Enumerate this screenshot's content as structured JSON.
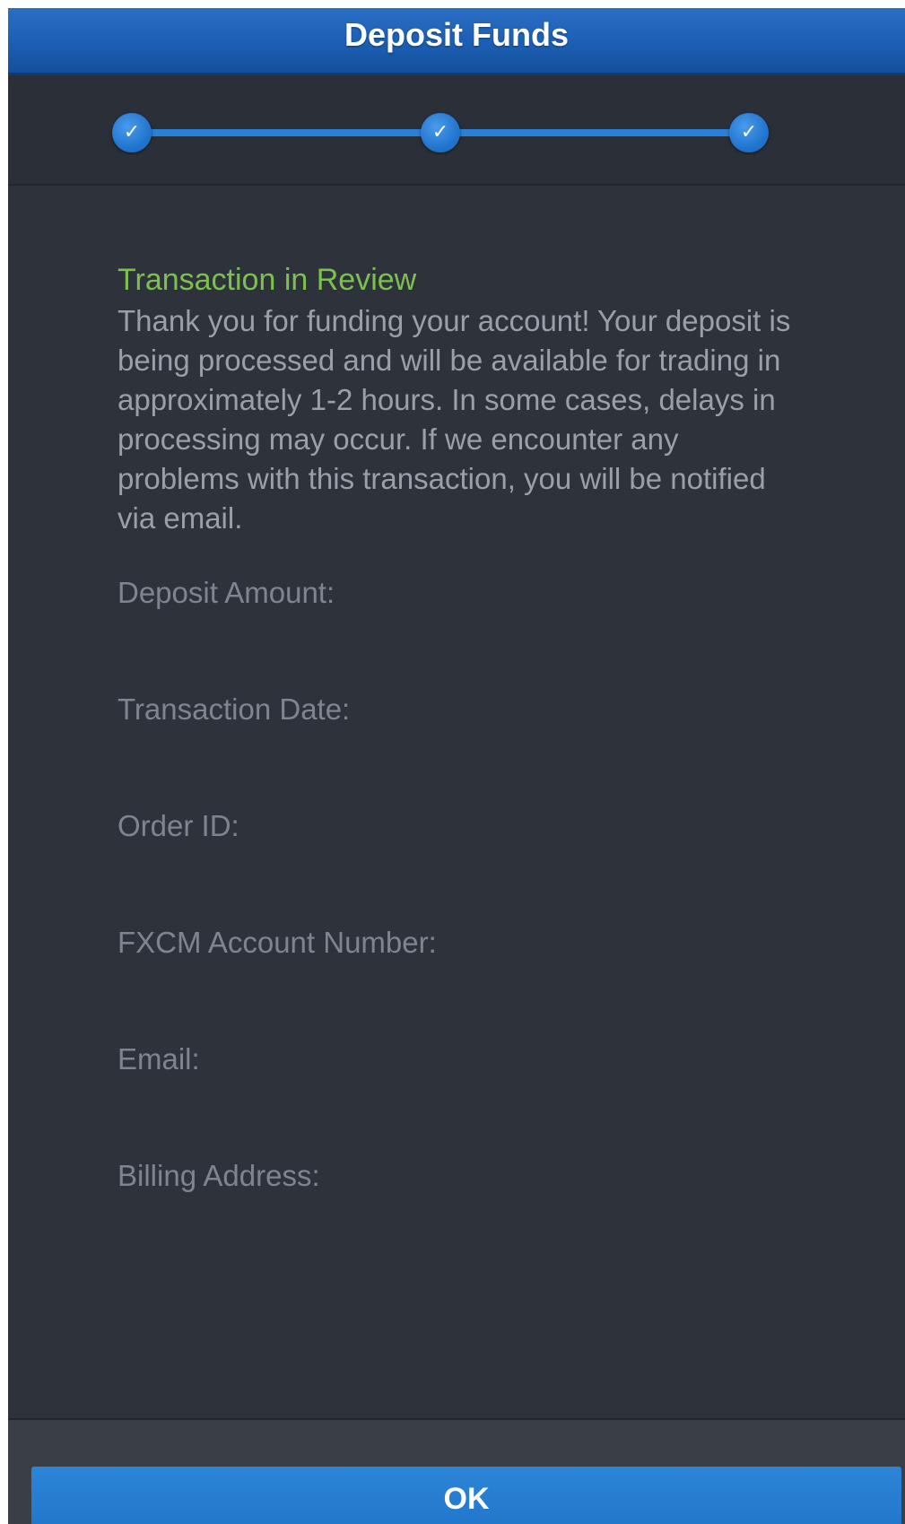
{
  "header": {
    "title": "Deposit Funds"
  },
  "stepper": {
    "steps": [
      {
        "state": "complete",
        "icon": "check-icon",
        "glyph": "✓"
      },
      {
        "state": "complete",
        "icon": "check-icon",
        "glyph": "✓"
      },
      {
        "state": "complete",
        "icon": "check-icon",
        "glyph": "✓"
      }
    ],
    "active_color": "#2a80d6"
  },
  "status": {
    "heading": "Transaction in Review",
    "heading_color": "#7cc04f",
    "message": "Thank you for funding your account! Your deposit is being processed and will be available for trading in approximately 1-2 hours. In some cases, delays in processing may occur. If we encounter any problems with this transaction, you will be notified via email."
  },
  "details": {
    "deposit_amount_label": "Deposit Amount:",
    "transaction_date_label": "Transaction Date:",
    "order_id_label": "Order ID:",
    "account_number_label": "FXCM Account Number:",
    "email_label": "Email:",
    "billing_address_label": "Billing Address:"
  },
  "footer": {
    "ok_label": "OK"
  }
}
